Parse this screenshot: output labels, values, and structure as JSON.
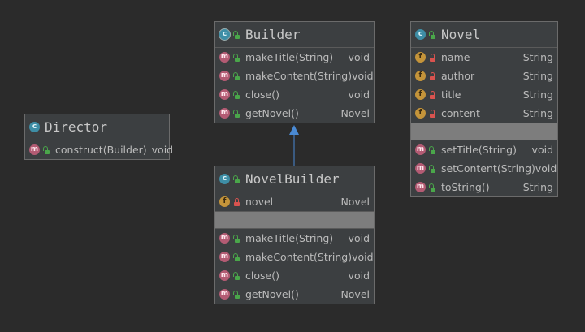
{
  "director": {
    "name": "Director",
    "kind_icon": "class-icon",
    "members": [
      {
        "kind": "m",
        "vis": "pub",
        "name": "construct(Builder)",
        "type": "void"
      }
    ]
  },
  "builder": {
    "name": "Builder",
    "kind_icon": "abstract-class-icon",
    "members": [
      {
        "kind": "m",
        "vis": "pub",
        "name": "makeTitle(String)",
        "type": "void"
      },
      {
        "kind": "m",
        "vis": "pub",
        "name": "makeContent(String)",
        "type": "void"
      },
      {
        "kind": "m",
        "vis": "pub",
        "name": "close()",
        "type": "void"
      },
      {
        "kind": "m",
        "vis": "pub",
        "name": "getNovel()",
        "type": "Novel"
      }
    ]
  },
  "novel_builder": {
    "name": "NovelBuilder",
    "kind_icon": "class-icon",
    "fields": [
      {
        "kind": "f",
        "vis": "priv",
        "name": "novel",
        "type": "Novel"
      }
    ],
    "methods": [
      {
        "kind": "m",
        "vis": "pub",
        "name": "makeTitle(String)",
        "type": "void"
      },
      {
        "kind": "m",
        "vis": "pub",
        "name": "makeContent(String)",
        "type": "void"
      },
      {
        "kind": "m",
        "vis": "pub",
        "name": "close()",
        "type": "void"
      },
      {
        "kind": "m",
        "vis": "pub",
        "name": "getNovel()",
        "type": "Novel"
      }
    ]
  },
  "novel": {
    "name": "Novel",
    "kind_icon": "class-icon",
    "fields": [
      {
        "kind": "f",
        "vis": "priv",
        "name": "name",
        "type": "String"
      },
      {
        "kind": "f",
        "vis": "priv",
        "name": "author",
        "type": "String"
      },
      {
        "kind": "f",
        "vis": "priv",
        "name": "title",
        "type": "String"
      },
      {
        "kind": "f",
        "vis": "priv",
        "name": "content",
        "type": "String"
      }
    ],
    "methods": [
      {
        "kind": "m",
        "vis": "pub",
        "name": "setTitle(String)",
        "type": "void"
      },
      {
        "kind": "m",
        "vis": "pub",
        "name": "setContent(String)",
        "type": "void"
      },
      {
        "kind": "m",
        "vis": "pub",
        "name": "toString()",
        "type": "String"
      }
    ]
  },
  "relations": [
    {
      "from": "NovelBuilder",
      "to": "Builder",
      "type": "inheritance"
    }
  ],
  "colors": {
    "background": "#2b2b2b",
    "box": "#3c3f41",
    "class_badge": "#3e8ea6",
    "method_badge": "#b35b73",
    "field_badge": "#c4943a",
    "public": "#4aa64a",
    "private": "#d9534f",
    "arrow": "#4a8ad4"
  }
}
